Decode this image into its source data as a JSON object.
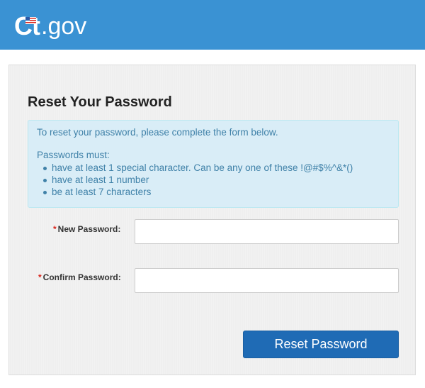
{
  "header": {
    "logo_ct": "Ct",
    "logo_gov": ".gov",
    "brand_color": "#3a92d3"
  },
  "form": {
    "title": "Reset Your Password",
    "info": {
      "intro": "To reset your password, please complete the form below.",
      "rules_heading": "Passwords must:",
      "rules": [
        "have at least 1 special character. Can be any one of these !@#$%^&*()",
        "have at least 1 number",
        "be at least 7 characters"
      ]
    },
    "new_password": {
      "required_marker": "*",
      "label": "New Password:",
      "value": "",
      "placeholder": ""
    },
    "confirm_password": {
      "required_marker": "*",
      "label": "Confirm Password:",
      "value": "",
      "placeholder": ""
    },
    "submit_label": "Reset Password",
    "accent_color": "#1f6bb5",
    "required_color": "#d9251c"
  }
}
